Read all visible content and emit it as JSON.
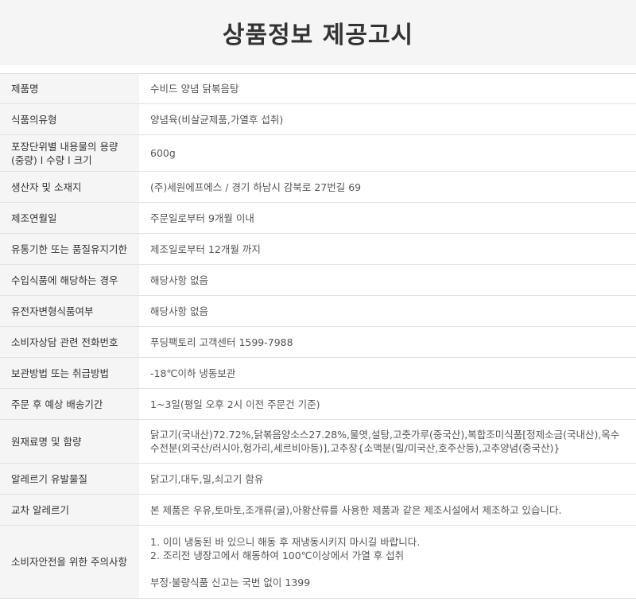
{
  "title": "상품정보 제공고시",
  "rows": [
    {
      "label": "제품명",
      "value": [
        "수비드 양념 닭볶음탕"
      ]
    },
    {
      "label": "식품의유형",
      "value": [
        "양념육(비살균제품,가열후 섭취)"
      ]
    },
    {
      "label": "포장단위별 내용물의 용량(중량) l 수량 l 크기",
      "value": [
        "600g"
      ]
    },
    {
      "label": "생산자 및 소재지",
      "value": [
        "(주)세원에프에스 / 경기 하남시 감북로 27번길 69"
      ]
    },
    {
      "label": "제조연월일",
      "value": [
        "주문일로부터 9개월 이내"
      ]
    },
    {
      "label": "유통기한 또는 품질유지기한",
      "value": [
        "제조일로부터 12개월 까지"
      ]
    },
    {
      "label": "수입식품에 해당하는 경우",
      "value": [
        "해당사항 없음"
      ]
    },
    {
      "label": "유전자변형식품여부",
      "value": [
        "해당사항 없음"
      ]
    },
    {
      "label": "소비자상담 관련 전화번호",
      "value": [
        "푸딩팩토리 고객센터 1599-7988"
      ]
    },
    {
      "label": "보관방법 또는 취급방법",
      "value": [
        "-18℃이하 냉동보관"
      ]
    },
    {
      "label": "주문 후 예상 배송기간",
      "value": [
        "1~3일(평일 오후 2시 이전 주문건 기준)"
      ]
    },
    {
      "label": "원재료명 및 함량",
      "value": [
        "닭고기(국내산)72.72%,닭볶음양소스27.28%,물엿,설탕,고춧가루(중국산),복합조미식품[정제소금(국내산),옥수수전분(외국산/러시아,헝가리,세르비아등)],고추장{소맥분(밀/미국산,호주산등),고추양념(중국산)}"
      ]
    },
    {
      "label": "알레르기 유발물질",
      "value": [
        "닭고기,대두,밀,쇠고기 함유"
      ]
    },
    {
      "label": "교차 알레르기",
      "value": [
        "본 제품은 우유,토마토,조개류(굴),아황산류를 사용한 제품과 같은 제조시설에서 제조하고 있습니다."
      ]
    },
    {
      "label": "소비자안전을 위한 주의사항",
      "value": [
        "1. 이미 냉동된 바 있으니 해동 후 재냉동시키지 마시길 바랍니다.",
        "2. 조리전 냉장고에서 해동하여 100℃이상에서 가열 후 섭취",
        "",
        "부정·불량식품 신고는 국번 없이 1399"
      ]
    }
  ]
}
